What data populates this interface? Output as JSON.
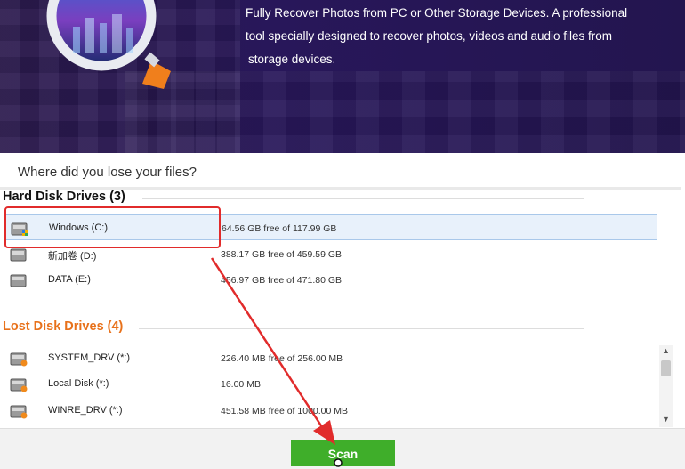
{
  "banner": {
    "description_lines": [
      "Fully Recover Photos from PC or Other Storage Devices. A professional",
      "tool specially designed to recover photos, videos and audio files from",
      "storage devices."
    ]
  },
  "question": "Where did you lose your files?",
  "hard_disk": {
    "title": "Hard Disk Drives (3)",
    "drives": [
      {
        "name": "Windows (C:)",
        "space": "64.56 GB free of 117.99 GB",
        "selected": true
      },
      {
        "name": "新加卷 (D:)",
        "space": "388.17 GB free of 459.59 GB",
        "selected": false
      },
      {
        "name": "DATA (E:)",
        "space": "456.97 GB free of 471.80 GB",
        "selected": false
      }
    ]
  },
  "lost_disk": {
    "title": "Lost Disk Drives (4)",
    "drives": [
      {
        "name": "SYSTEM_DRV (*:)",
        "space": "226.40 MB free of 256.00 MB"
      },
      {
        "name": "Local Disk (*:)",
        "space": "16.00 MB"
      },
      {
        "name": "WINRE_DRV (*:)",
        "space": "451.58 MB free of 1000.00 MB"
      }
    ]
  },
  "scan_label": "Scan",
  "colors": {
    "accent_orange": "#e8711a",
    "scan_green": "#3fae2a",
    "annotation_red": "#e12b2b",
    "banner_purple": "#28175a"
  },
  "icons": {
    "magnifier": "magnifier-icon",
    "drive": "hard-drive-icon",
    "windows_badge": "windows-badge-icon",
    "warning_badge": "warning-badge-icon"
  }
}
